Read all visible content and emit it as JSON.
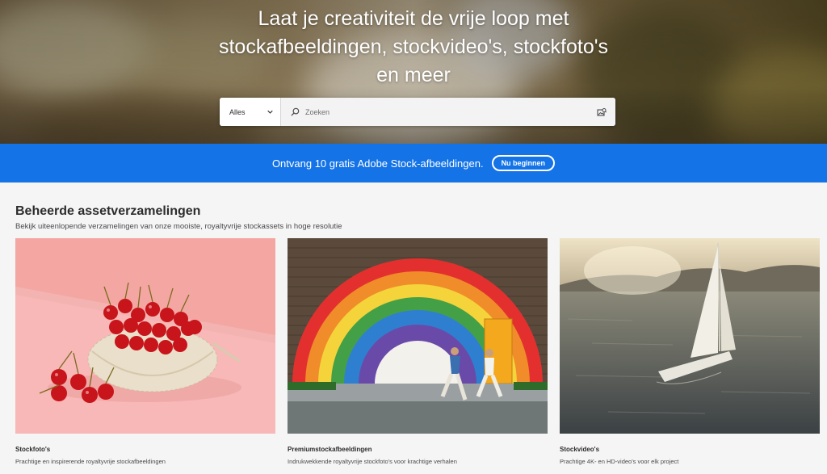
{
  "hero": {
    "title_line1": "Laat je creativiteit de vrije loop met",
    "title_line2": "stockafbeeldingen, stockvideo's, stockfoto's",
    "title_line3": "en meer"
  },
  "search": {
    "category": "Alles",
    "placeholder": "Zoeken",
    "icons": [
      "chevron-down-icon",
      "search-icon",
      "visual-search-icon"
    ]
  },
  "promo": {
    "text": "Ontvang 10 gratis Adobe Stock-afbeeldingen.",
    "button_label": "Nu beginnen"
  },
  "collections": {
    "title": "Beheerde assetverzamelingen",
    "subtitle": "Bekijk uiteenlopende verzamelingen van onze mooiste, royaltyvrije stockassets in hoge resolutie",
    "cards": [
      {
        "title": "Stockfoto's",
        "description": "Prachtige en inspirerende royaltyvrije stockafbeeldingen"
      },
      {
        "title": "Premiumstockafbeeldingen",
        "description": "Indrukwekkende royaltyvrije stockfoto's voor krachtige verhalen"
      },
      {
        "title": "Stockvideo's",
        "description": "Prachtige 4K- en HD-video's voor elk project"
      }
    ]
  },
  "colors": {
    "promo_blue": "#1473e6",
    "text_dark": "#2c2c2c",
    "page_bg": "#f5f5f5"
  }
}
